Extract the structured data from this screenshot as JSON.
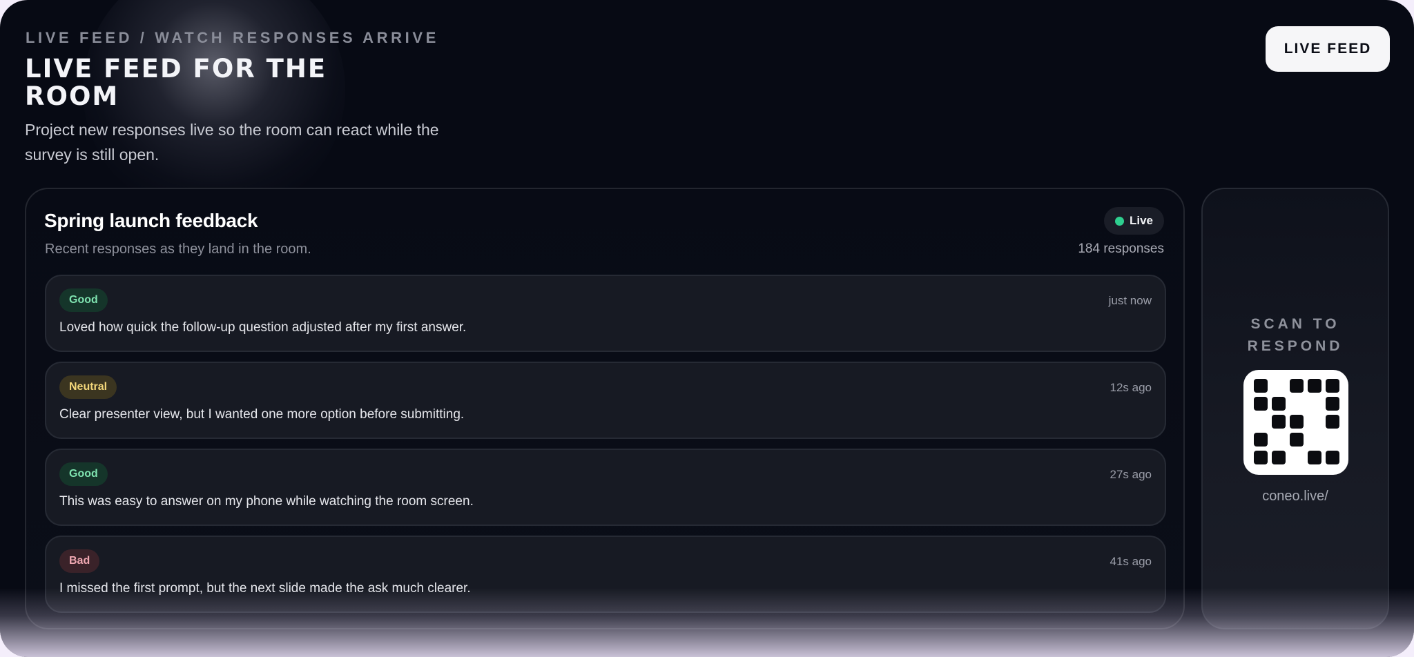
{
  "header": {
    "eyebrow": "LIVE FEED / WATCH RESPONSES ARRIVE",
    "title": "LIVE FEED FOR THE ROOM",
    "subtitle": "Project new responses live so the room can react while the survey is still open.",
    "pill_label": "LIVE FEED"
  },
  "feed": {
    "title": "Spring launch feedback",
    "subtitle": "Recent responses as they land in the room.",
    "status_label": "Live",
    "status_color": "#2ecf8f",
    "count": "184 responses",
    "items": [
      {
        "tag": "Good",
        "tone": "good",
        "time": "just now",
        "text": "Loved how quick the follow-up question adjusted after my first answer."
      },
      {
        "tag": "Neutral",
        "tone": "neutral",
        "time": "12s ago",
        "text": "Clear presenter view, but I wanted one more option before submitting."
      },
      {
        "tag": "Good",
        "tone": "good",
        "time": "27s ago",
        "text": "This was easy to answer on my phone while watching the room screen."
      },
      {
        "tag": "Bad",
        "tone": "bad",
        "time": "41s ago",
        "text": "I missed the first prompt, but the next slide made the ask much clearer."
      }
    ]
  },
  "qr": {
    "label": "SCAN TO RESPOND",
    "url": "coneo.live/",
    "icon": "qr-code-icon",
    "pattern": [
      [
        1,
        0,
        1,
        1,
        1
      ],
      [
        1,
        1,
        0,
        0,
        1
      ],
      [
        0,
        1,
        1,
        0,
        1
      ],
      [
        1,
        0,
        1,
        0,
        0
      ],
      [
        1,
        1,
        0,
        1,
        1
      ]
    ]
  }
}
